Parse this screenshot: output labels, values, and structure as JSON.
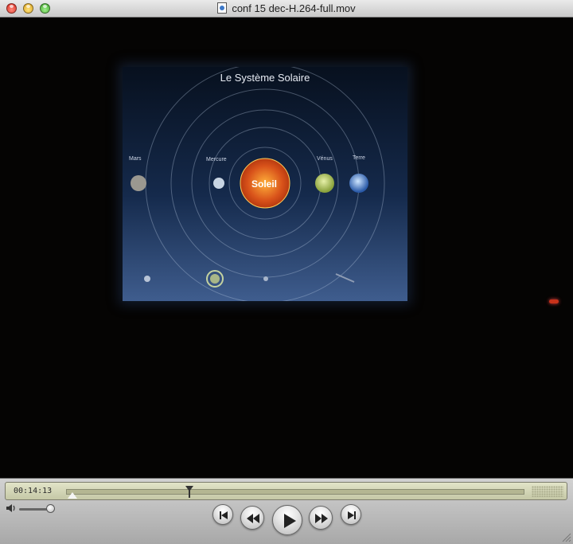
{
  "window": {
    "title": "conf 15 dec-H.264-full.mov"
  },
  "video": {
    "slide_title": "Le Système Solaire",
    "planets": {
      "mars": "Mars",
      "mercure": "Mercure",
      "soleil": "Soleil",
      "venus": "Vénus",
      "terre": "Terre"
    }
  },
  "controller": {
    "current_time": "00:14:13",
    "colors": {
      "lcd": "#d6d8b8",
      "track": "#b4b692"
    }
  }
}
